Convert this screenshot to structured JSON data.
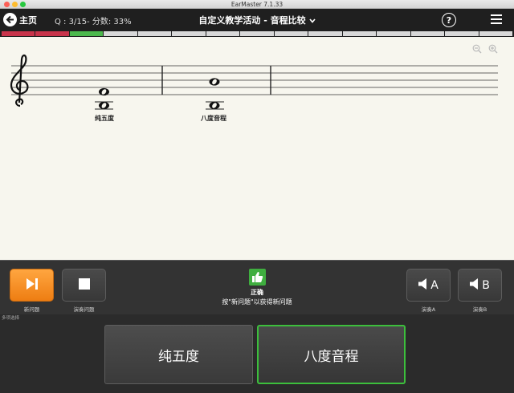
{
  "window": {
    "title": "EarMaster 7.1.33"
  },
  "header": {
    "home_label": "主页",
    "score_text": "Q : 3/15- 分数: 33%",
    "activity_title": "自定义教学活动 - 音程比较",
    "help_label": "?"
  },
  "progress": {
    "total": 15,
    "current": 3,
    "states": [
      "wrong",
      "wrong",
      "current",
      "pending",
      "pending",
      "pending",
      "pending",
      "pending",
      "pending",
      "pending",
      "pending",
      "pending",
      "pending",
      "pending",
      "pending"
    ],
    "colors": {
      "wrong": "#c8344b",
      "current": "#4cb84c",
      "pending": "#d8d8d8"
    }
  },
  "score_view": {
    "interval_a_label": "纯五度",
    "interval_b_label": "八度音程"
  },
  "controls": {
    "new_question_label": "新问题",
    "play_question_label": "演奏问题",
    "feedback_title": "正确",
    "feedback_hint": "按\"新问题\"以获得新问题",
    "play_a_letter": "A",
    "play_a_label": "演奏A",
    "play_b_letter": "B",
    "play_b_label": "演奏B"
  },
  "answers": {
    "section_label": "多项选择",
    "options": [
      {
        "label": "纯五度"
      },
      {
        "label": "八度音程"
      }
    ]
  },
  "colors": {
    "accent_orange": "#ff9a2e",
    "correct_green": "#3cbf3c",
    "paper": "#f7f6ee"
  }
}
